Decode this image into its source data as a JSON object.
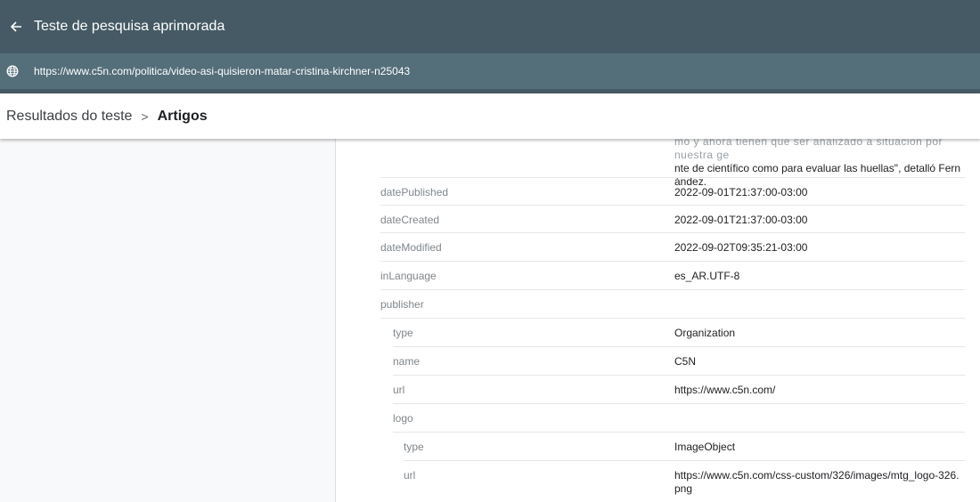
{
  "header": {
    "title": "Teste de pesquisa aprimorada",
    "url": "https://www.c5n.com/politica/video-asi-quisieron-matar-cristina-kirchner-n25043"
  },
  "breadcrumb": {
    "parent": "Resultados do teste",
    "separator": ">",
    "current": "Artigos"
  },
  "fragment": {
    "line1": "mo y ahora tienen que ser analizado a situación por nuestra ge",
    "line2": "nte de científico como para evaluar las huellas\", detalló Fern",
    "line3": "ández."
  },
  "rows": [
    {
      "key": "datePublished",
      "value": "2022-09-01T21:37:00-03:00"
    },
    {
      "key": "dateCreated",
      "value": "2022-09-01T21:37:00-03:00"
    },
    {
      "key": "dateModified",
      "value": "2022-09-02T09:35:21-03:00"
    },
    {
      "key": "inLanguage",
      "value": "es_AR.UTF-8"
    },
    {
      "key": "publisher",
      "value": ""
    },
    {
      "key": "type",
      "value": "Organization"
    },
    {
      "key": "name",
      "value": "C5N"
    },
    {
      "key": "url",
      "value": "https://www.c5n.com/"
    },
    {
      "key": "logo",
      "value": ""
    },
    {
      "key": "type",
      "value": "ImageObject"
    },
    {
      "key": "url",
      "value": "https://www.c5n.com/css-custom/326/images/mtg_logo-326.png"
    }
  ],
  "colors": {
    "header_bg": "#455a64",
    "urlbar_bg": "#546e7a",
    "key_text": "#80868b"
  }
}
